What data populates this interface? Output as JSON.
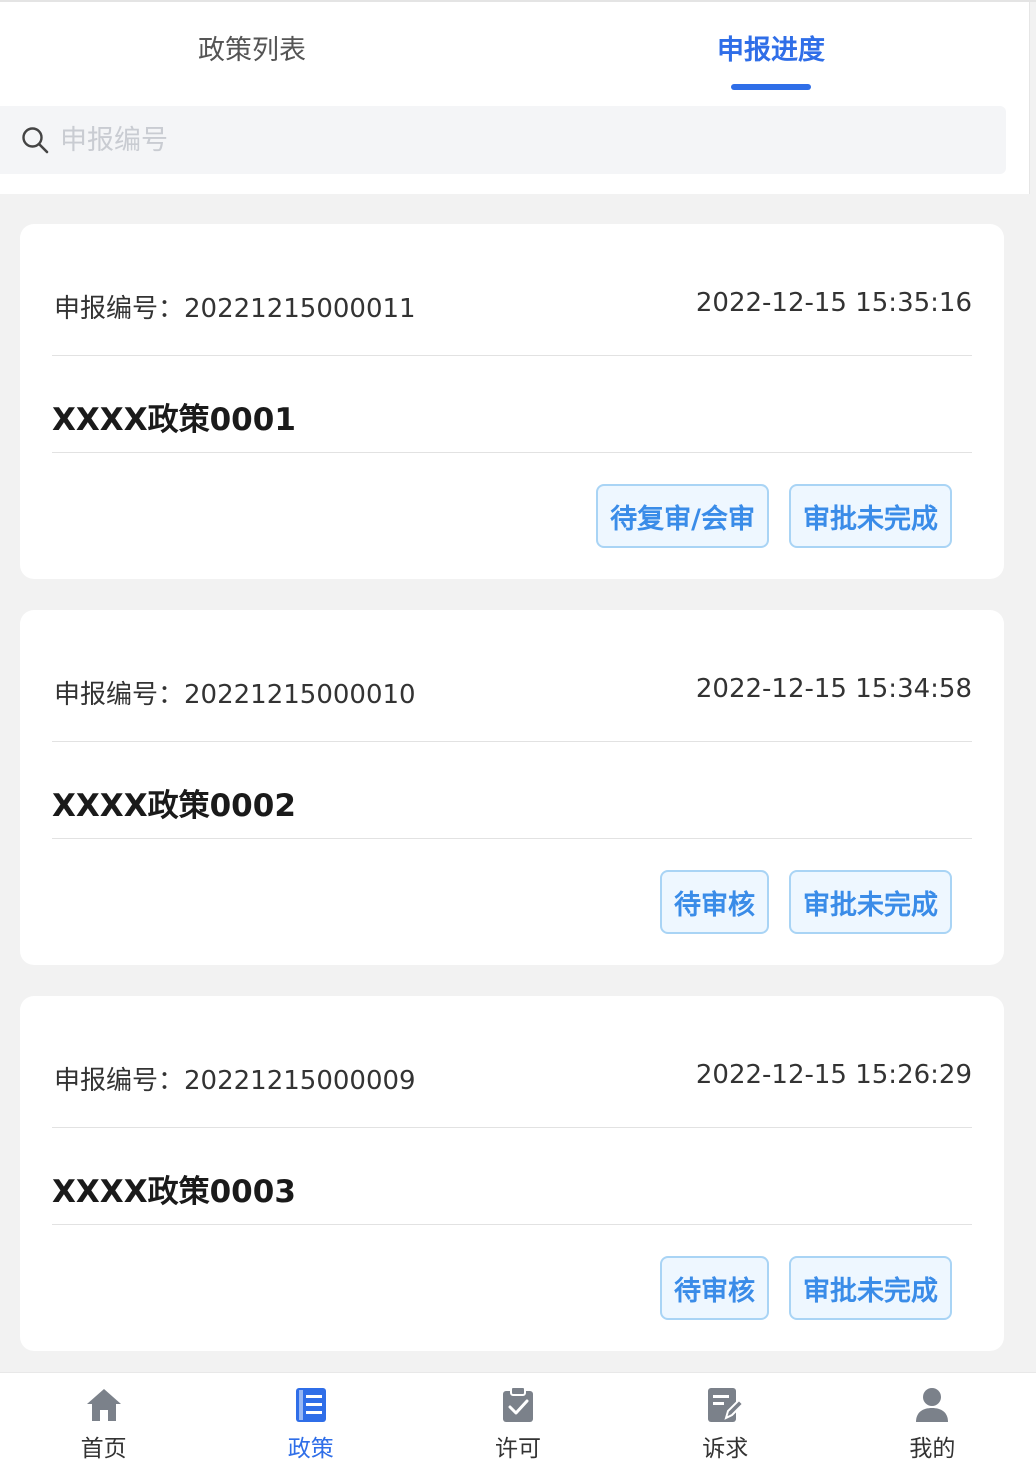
{
  "tabs": {
    "policy_list": "政策列表",
    "progress": "申报进度",
    "active_color": "#2f6ee8"
  },
  "search": {
    "placeholder": "申报编号",
    "value": ""
  },
  "records": [
    {
      "number_text": "申报编号：20221215000011",
      "datetime": "2022-12-15 15:35:16",
      "title": "XXXX政策0001",
      "tags": [
        "待复审/会审",
        "审批未完成"
      ]
    },
    {
      "number_text": "申报编号：20221215000010",
      "datetime": "2022-12-15 15:34:58",
      "title": "XXXX政策0002",
      "tags": [
        "待审核",
        "审批未完成"
      ]
    },
    {
      "number_text": "申报编号：20221215000009",
      "datetime": "2022-12-15 15:26:29",
      "title": "XXXX政策0003",
      "tags": [
        "待审核",
        "审批未完成"
      ]
    }
  ],
  "tabbar": {
    "items": [
      {
        "label": "首页",
        "icon": "home-icon"
      },
      {
        "label": "政策",
        "icon": "policy-book-icon"
      },
      {
        "label": "许可",
        "icon": "clipboard-check-icon"
      },
      {
        "label": "诉求",
        "icon": "edit-note-icon"
      },
      {
        "label": "我的",
        "icon": "user-icon"
      }
    ],
    "active_index": 1
  }
}
